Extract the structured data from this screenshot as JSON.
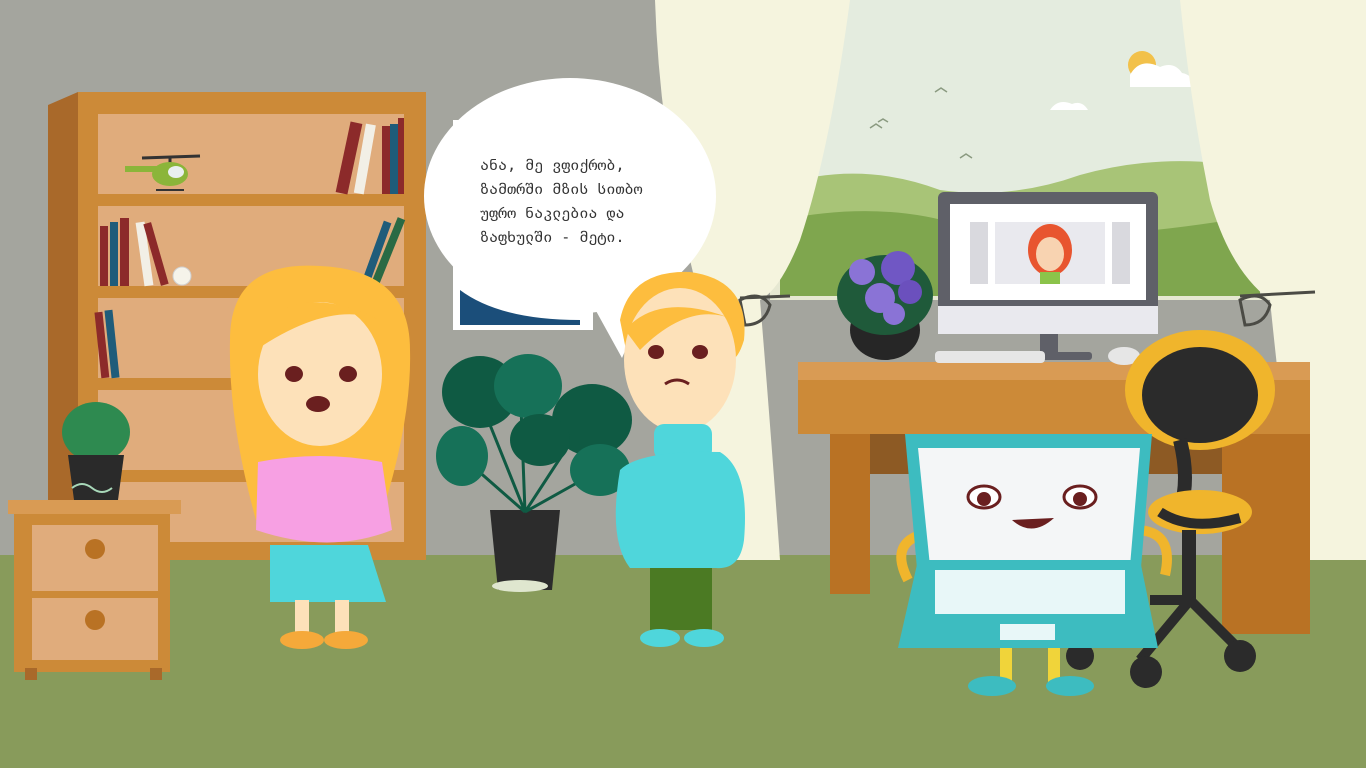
{
  "speech_bubble": {
    "lines": [
      "ანა, მე ვფიქრობ,",
      "ზამთრში მზის სითბო",
      "უფრო ნაკლებია და",
      "ზაფხულში - მეტი."
    ]
  },
  "colors": {
    "wall": "#a4a59e",
    "floor": "#889b5b",
    "wood": "#cc8a38",
    "girl_shirt": "#f7a0e3",
    "boy_sweater": "#4fd6db",
    "laptop_body": "#3dbcc0"
  },
  "characters": [
    "girl",
    "boy",
    "laptop-character",
    "monitor-avatar"
  ]
}
